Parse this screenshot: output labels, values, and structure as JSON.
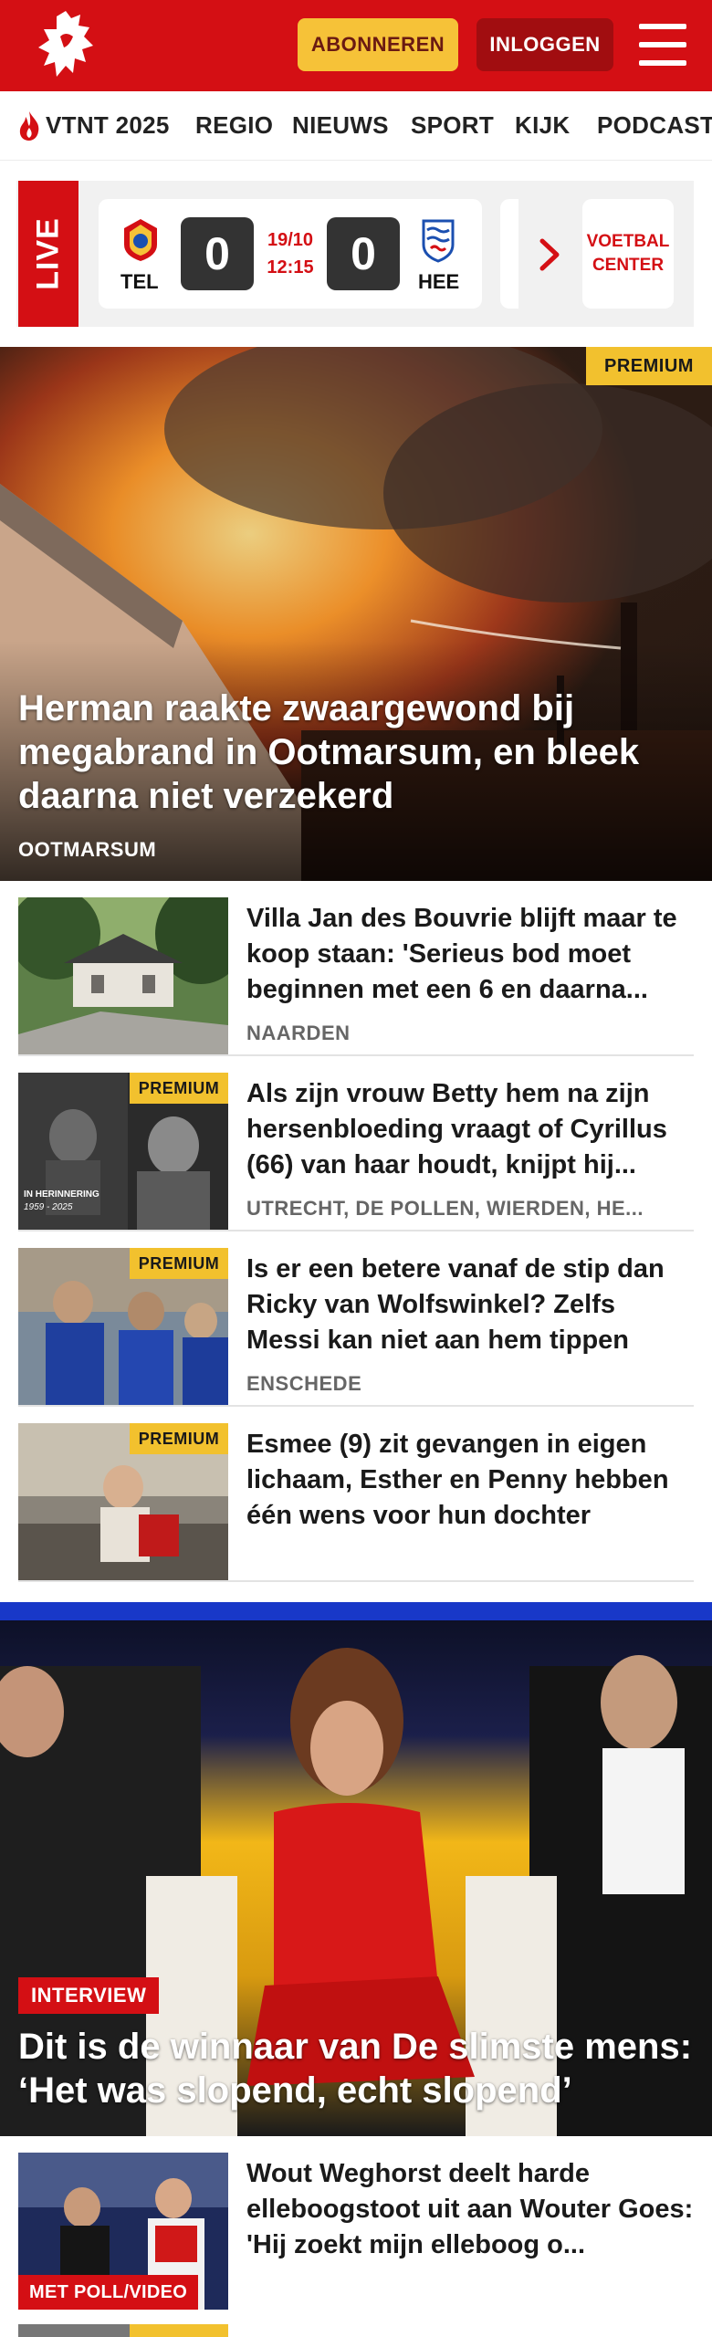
{
  "header": {
    "subscribe_label": "ABONNEREN",
    "login_label": "INLOGGEN",
    "brand_color": "#d40f14",
    "accent_color": "#f6c238"
  },
  "nav": {
    "items": [
      "VTNT 2025",
      "REGIO",
      "NIEUWS",
      "SPORT",
      "KIJK",
      "PODCAST"
    ]
  },
  "live": {
    "label": "LIVE",
    "match": {
      "home_code": "TEL",
      "home_score": "0",
      "date": "19/10",
      "time": "12:15",
      "away_score": "0",
      "away_code": "HEE"
    },
    "center_line1": "VOETBAL",
    "center_line2": "CENTER"
  },
  "hero": {
    "badge": "PREMIUM",
    "title": "Herman raakte zwaargewond bij megabrand in Ootmarsum, en bleek daarna niet verzekerd",
    "location": "OOTMARSUM"
  },
  "articles": [
    {
      "title": "Villa Jan des Bouvrie blijft maar te koop staan: 'Serieus bod moet beginnen met een 6 en daarna...",
      "location": "NAARDEN",
      "badge": ""
    },
    {
      "title": "Als zijn vrouw Betty hem na zijn hersenbloeding vraagt of Cyrillus (66) van haar houdt, knijpt hij...",
      "location": "UTRECHT, DE POLLEN, WIERDEN, HE...",
      "badge": "PREMIUM",
      "thumb_caption_1": "IN HERINNERING",
      "thumb_caption_2": "1959 - 2025"
    },
    {
      "title": "Is er een betere vanaf de stip dan Ricky van Wolfswinkel? Zelfs Messi kan niet aan hem tippen",
      "location": "ENSCHEDE",
      "badge": "PREMIUM"
    },
    {
      "title": "Esmee (9) zit gevangen in eigen lichaam, Esther en Penny hebben één wens voor hun dochter",
      "location": "",
      "badge": "PREMIUM"
    }
  ],
  "feature": {
    "label": "INTERVIEW",
    "title": "Dit is de winnaar van De slimste mens: ‘Het was slopend, echt slopend’"
  },
  "articles2": [
    {
      "title": "Wout Weghorst deelt harde elleboogstoot uit aan Wouter Goes: 'Hij zoekt mijn elleboog o...",
      "label": "MET POLL/VIDEO"
    }
  ]
}
